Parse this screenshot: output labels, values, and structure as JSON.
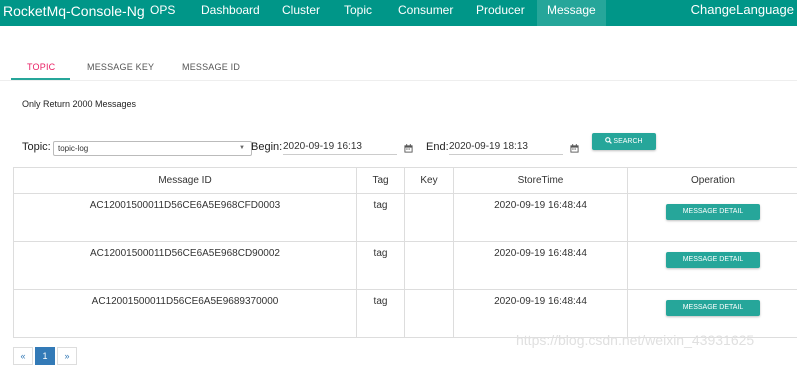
{
  "navbar": {
    "brand": "RocketMq-Console-Ng",
    "items": [
      "OPS",
      "Dashboard",
      "Cluster",
      "Topic",
      "Consumer",
      "Producer",
      "Message"
    ],
    "active": "Message",
    "language": "ChangeLanguage"
  },
  "tabs": [
    "TOPIC",
    "MESSAGE KEY",
    "MESSAGE ID"
  ],
  "active_tab": "TOPIC",
  "note": "Only Return 2000 Messages",
  "query": {
    "topic_label": "Topic:",
    "topic_value": "topic-log",
    "begin_label": "Begin:",
    "begin_value": "2020-09-19 16:13",
    "end_label": "End:",
    "end_value": "2020-09-19 18:13",
    "search_label": "SEARCH"
  },
  "table": {
    "headers": [
      "Message ID",
      "Tag",
      "Key",
      "StoreTime",
      "Operation"
    ],
    "rows": [
      {
        "id": "AC12001500011D56CE6A5E968CFD0003",
        "tag": "tag",
        "key": "",
        "store_time": "2020-09-19 16:48:44",
        "action": "MESSAGE DETAIL"
      },
      {
        "id": "AC12001500011D56CE6A5E968CD90002",
        "tag": "tag",
        "key": "",
        "store_time": "2020-09-19 16:48:44",
        "action": "MESSAGE DETAIL"
      },
      {
        "id": "AC12001500011D56CE6A5E9689370000",
        "tag": "tag",
        "key": "",
        "store_time": "2020-09-19 16:48:44",
        "action": "MESSAGE DETAIL"
      }
    ]
  },
  "pagination": {
    "prev": "«",
    "current": "1",
    "next": "»"
  },
  "watermark": "https://blog.csdn.net/weixin_43931625",
  "colors": {
    "primary": "#009688",
    "accent": "#26a69a",
    "tab_active": "#e91e63",
    "page_active": "#337ab7"
  }
}
